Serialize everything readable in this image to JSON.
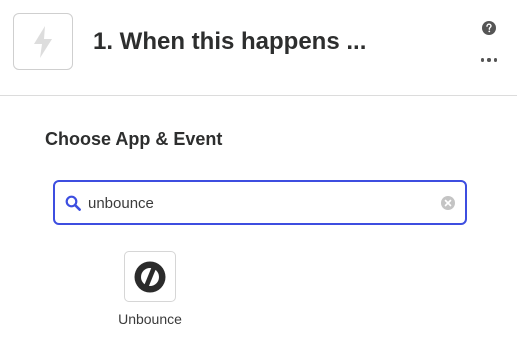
{
  "step": {
    "title": "1. When this happens ...",
    "trigger_icon": "bolt-icon"
  },
  "header": {
    "help_icon": "help-circle-icon",
    "more_icon": "more-horizontal-icon"
  },
  "section": {
    "title": "Choose App & Event"
  },
  "search": {
    "value": "unbounce",
    "accent": "#3d4ee0"
  },
  "results": [
    {
      "label": "Unbounce",
      "icon": "unbounce-logo-icon"
    }
  ]
}
